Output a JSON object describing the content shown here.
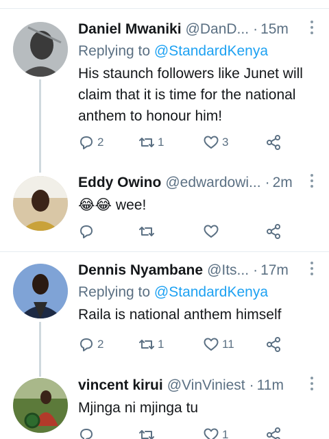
{
  "tweets": [
    {
      "name": "Daniel Mwaniki",
      "handle": "@DanD...",
      "time": "15m",
      "replying_prefix": "Replying to",
      "replying_to": "@StandardKenya",
      "text": "His staunch followers like Junet will claim that it is time for the national anthem to honour him!",
      "replies": "2",
      "retweets": "1",
      "likes": "3"
    },
    {
      "name": "Eddy Owino",
      "handle": "@edwardowi...",
      "time": "2m",
      "text": "wee!",
      "emoji": "😂😂",
      "replies": "",
      "retweets": "",
      "likes": ""
    },
    {
      "name": "Dennis Nyambane",
      "handle": "@Its...",
      "time": "17m",
      "replying_prefix": "Replying to",
      "replying_to": "@StandardKenya",
      "text": "Raila is  national anthem himself",
      "replies": "2",
      "retweets": "1",
      "likes": "11"
    },
    {
      "name": "vincent kirui",
      "handle": "@VinViniest",
      "time": "11m",
      "text": "Mjinga ni mjinga tu",
      "replies": "",
      "retweets": "",
      "likes": "1"
    }
  ],
  "icons": {
    "reply": "reply-icon",
    "retweet": "retweet-icon",
    "like": "heart-icon",
    "share": "share-icon",
    "more": "more-vertical-icon"
  },
  "colors": {
    "link": "#1da1f2",
    "secondary_text": "#5b7083",
    "thread_line": "#cfd9de"
  }
}
